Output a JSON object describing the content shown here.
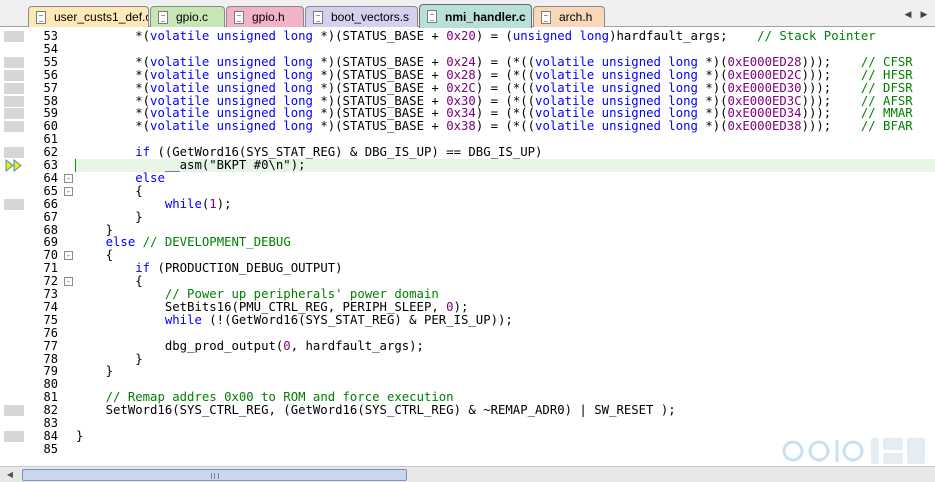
{
  "tabs": [
    {
      "label": "user_custs1_def.c",
      "color": "#fde9b8",
      "active": false
    },
    {
      "label": "gpio.c",
      "color": "#c8e6b4",
      "active": false
    },
    {
      "label": "gpio.h",
      "color": "#f2b2c8",
      "active": false
    },
    {
      "label": "boot_vectors.s",
      "color": "#d6d0ee",
      "active": false
    },
    {
      "label": "nmi_handler.c",
      "color": "#b8e0d8",
      "active": true
    },
    {
      "label": "arch.h",
      "color": "#f8d8b8",
      "active": false
    }
  ],
  "tab_scroll": {
    "left_icon": "chevron-left-icon",
    "right_icon": "chevron-right-icon"
  },
  "editor": {
    "current_line": 63,
    "lines": [
      {
        "n": "53",
        "bp": true,
        "fold": "",
        "tokens": [
          [
            "p",
            "        *("
          ],
          [
            "k",
            "volatile unsigned long"
          ],
          [
            "p",
            " *)(STATUS_BASE + "
          ],
          [
            "n",
            "0x20"
          ],
          [
            "p",
            ") = ("
          ],
          [
            "k",
            "unsigned long"
          ],
          [
            "p",
            ")hardfault_args;    "
          ],
          [
            "c",
            "// Stack Pointer"
          ]
        ]
      },
      {
        "n": "54",
        "bp": false,
        "fold": "",
        "tokens": []
      },
      {
        "n": "55",
        "bp": true,
        "fold": "",
        "tokens": [
          [
            "p",
            "        *("
          ],
          [
            "k",
            "volatile unsigned long"
          ],
          [
            "p",
            " *)(STATUS_BASE + "
          ],
          [
            "n",
            "0x24"
          ],
          [
            "p",
            ") = (*(("
          ],
          [
            "k",
            "volatile unsigned long"
          ],
          [
            "p",
            " *)("
          ],
          [
            "n",
            "0xE000ED28"
          ],
          [
            "p",
            ")));    "
          ],
          [
            "c",
            "// CFSR"
          ]
        ]
      },
      {
        "n": "56",
        "bp": true,
        "fold": "",
        "tokens": [
          [
            "p",
            "        *("
          ],
          [
            "k",
            "volatile unsigned long"
          ],
          [
            "p",
            " *)(STATUS_BASE + "
          ],
          [
            "n",
            "0x28"
          ],
          [
            "p",
            ") = (*(("
          ],
          [
            "k",
            "volatile unsigned long"
          ],
          [
            "p",
            " *)("
          ],
          [
            "n",
            "0xE000ED2C"
          ],
          [
            "p",
            ")));    "
          ],
          [
            "c",
            "// HFSR"
          ]
        ]
      },
      {
        "n": "57",
        "bp": true,
        "fold": "",
        "tokens": [
          [
            "p",
            "        *("
          ],
          [
            "k",
            "volatile unsigned long"
          ],
          [
            "p",
            " *)(STATUS_BASE + "
          ],
          [
            "n",
            "0x2C"
          ],
          [
            "p",
            ") = (*(("
          ],
          [
            "k",
            "volatile unsigned long"
          ],
          [
            "p",
            " *)("
          ],
          [
            "n",
            "0xE000ED30"
          ],
          [
            "p",
            ")));    "
          ],
          [
            "c",
            "// DFSR"
          ]
        ]
      },
      {
        "n": "58",
        "bp": true,
        "fold": "",
        "tokens": [
          [
            "p",
            "        *("
          ],
          [
            "k",
            "volatile unsigned long"
          ],
          [
            "p",
            " *)(STATUS_BASE + "
          ],
          [
            "n",
            "0x30"
          ],
          [
            "p",
            ") = (*(("
          ],
          [
            "k",
            "volatile unsigned long"
          ],
          [
            "p",
            " *)("
          ],
          [
            "n",
            "0xE000ED3C"
          ],
          [
            "p",
            ")));    "
          ],
          [
            "c",
            "// AFSR"
          ]
        ]
      },
      {
        "n": "59",
        "bp": true,
        "fold": "",
        "tokens": [
          [
            "p",
            "        *("
          ],
          [
            "k",
            "volatile unsigned long"
          ],
          [
            "p",
            " *)(STATUS_BASE + "
          ],
          [
            "n",
            "0x34"
          ],
          [
            "p",
            ") = (*(("
          ],
          [
            "k",
            "volatile unsigned long"
          ],
          [
            "p",
            " *)("
          ],
          [
            "n",
            "0xE000ED34"
          ],
          [
            "p",
            ")));    "
          ],
          [
            "c",
            "// MMAR"
          ]
        ]
      },
      {
        "n": "60",
        "bp": true,
        "fold": "",
        "tokens": [
          [
            "p",
            "        *("
          ],
          [
            "k",
            "volatile unsigned long"
          ],
          [
            "p",
            " *)(STATUS_BASE + "
          ],
          [
            "n",
            "0x38"
          ],
          [
            "p",
            ") = (*(("
          ],
          [
            "k",
            "volatile unsigned long"
          ],
          [
            "p",
            " *)("
          ],
          [
            "n",
            "0xE000ED38"
          ],
          [
            "p",
            ")));    "
          ],
          [
            "c",
            "// BFAR"
          ]
        ]
      },
      {
        "n": "61",
        "bp": false,
        "fold": "",
        "tokens": []
      },
      {
        "n": "62",
        "bp": true,
        "fold": "",
        "tokens": [
          [
            "p",
            "        "
          ],
          [
            "k",
            "if"
          ],
          [
            "p",
            " ((GetWord16(SYS_STAT_REG) & DBG_IS_UP) == DBG_IS_UP)"
          ]
        ]
      },
      {
        "n": "63",
        "bp": false,
        "fold": "",
        "exec": true,
        "tokens": [
          [
            "p",
            "            __asm(\"BKPT #0\\n\");"
          ]
        ]
      },
      {
        "n": "64",
        "bp": false,
        "fold": "-",
        "tokens": [
          [
            "p",
            "        "
          ],
          [
            "k",
            "else"
          ]
        ]
      },
      {
        "n": "65",
        "bp": false,
        "fold": "-",
        "tokens": [
          [
            "p",
            "        {"
          ]
        ]
      },
      {
        "n": "66",
        "bp": true,
        "fold": "",
        "tokens": [
          [
            "p",
            "            "
          ],
          [
            "k",
            "while"
          ],
          [
            "p",
            "("
          ],
          [
            "n",
            "1"
          ],
          [
            "p",
            ");"
          ]
        ]
      },
      {
        "n": "67",
        "bp": false,
        "fold": "",
        "tokens": [
          [
            "p",
            "        }"
          ]
        ]
      },
      {
        "n": "68",
        "bp": false,
        "fold": "",
        "tokens": [
          [
            "p",
            "    }"
          ]
        ]
      },
      {
        "n": "69",
        "bp": false,
        "fold": "",
        "tokens": [
          [
            "p",
            "    "
          ],
          [
            "k",
            "else"
          ],
          [
            "p",
            " "
          ],
          [
            "c",
            "// DEVELOPMENT_DEBUG"
          ]
        ]
      },
      {
        "n": "70",
        "bp": false,
        "fold": "-",
        "tokens": [
          [
            "p",
            "    {"
          ]
        ]
      },
      {
        "n": "71",
        "bp": false,
        "fold": "",
        "tokens": [
          [
            "p",
            "        "
          ],
          [
            "k",
            "if"
          ],
          [
            "p",
            " (PRODUCTION_DEBUG_OUTPUT)"
          ]
        ]
      },
      {
        "n": "72",
        "bp": false,
        "fold": "-",
        "tokens": [
          [
            "p",
            "        {"
          ]
        ]
      },
      {
        "n": "73",
        "bp": false,
        "fold": "",
        "tokens": [
          [
            "p",
            "            "
          ],
          [
            "c",
            "// Power up peripherals' power domain"
          ]
        ]
      },
      {
        "n": "74",
        "bp": false,
        "fold": "",
        "tokens": [
          [
            "p",
            "            SetBits16(PMU_CTRL_REG, PERIPH_SLEEP, "
          ],
          [
            "n",
            "0"
          ],
          [
            "p",
            ");"
          ]
        ]
      },
      {
        "n": "75",
        "bp": false,
        "fold": "",
        "tokens": [
          [
            "p",
            "            "
          ],
          [
            "k",
            "while"
          ],
          [
            "p",
            " (!(GetWord16(SYS_STAT_REG) & PER_IS_UP));"
          ]
        ]
      },
      {
        "n": "76",
        "bp": false,
        "fold": "",
        "tokens": []
      },
      {
        "n": "77",
        "bp": false,
        "fold": "",
        "tokens": [
          [
            "p",
            "            dbg_prod_output("
          ],
          [
            "n",
            "0"
          ],
          [
            "p",
            ", hardfault_args);"
          ]
        ]
      },
      {
        "n": "78",
        "bp": false,
        "fold": "",
        "tokens": [
          [
            "p",
            "        }"
          ]
        ]
      },
      {
        "n": "79",
        "bp": false,
        "fold": "",
        "tokens": [
          [
            "p",
            "    }"
          ]
        ]
      },
      {
        "n": "80",
        "bp": false,
        "fold": "",
        "tokens": []
      },
      {
        "n": "81",
        "bp": false,
        "fold": "",
        "tokens": [
          [
            "p",
            "    "
          ],
          [
            "c",
            "// Remap addres 0x00 to ROM and force execution"
          ]
        ]
      },
      {
        "n": "82",
        "bp": true,
        "fold": "",
        "tokens": [
          [
            "p",
            "    SetWord16(SYS_CTRL_REG, (GetWord16(SYS_CTRL_REG) & ~REMAP_ADR0) | SW_RESET );"
          ]
        ]
      },
      {
        "n": "83",
        "bp": false,
        "fold": "",
        "tokens": []
      },
      {
        "n": "84",
        "bp": true,
        "fold": "",
        "tokens": [
          [
            "p",
            "}"
          ]
        ]
      },
      {
        "n": "85",
        "bp": false,
        "fold": "",
        "tokens": []
      }
    ]
  },
  "scrollbar": {
    "left_icon": "arrow-left-icon",
    "right_icon": "arrow-right-icon"
  },
  "colors": {
    "keyword": "#0000ff",
    "number": "#800080",
    "comment": "#008000"
  },
  "watermark": {
    "icon": "site-logo-watermark"
  }
}
